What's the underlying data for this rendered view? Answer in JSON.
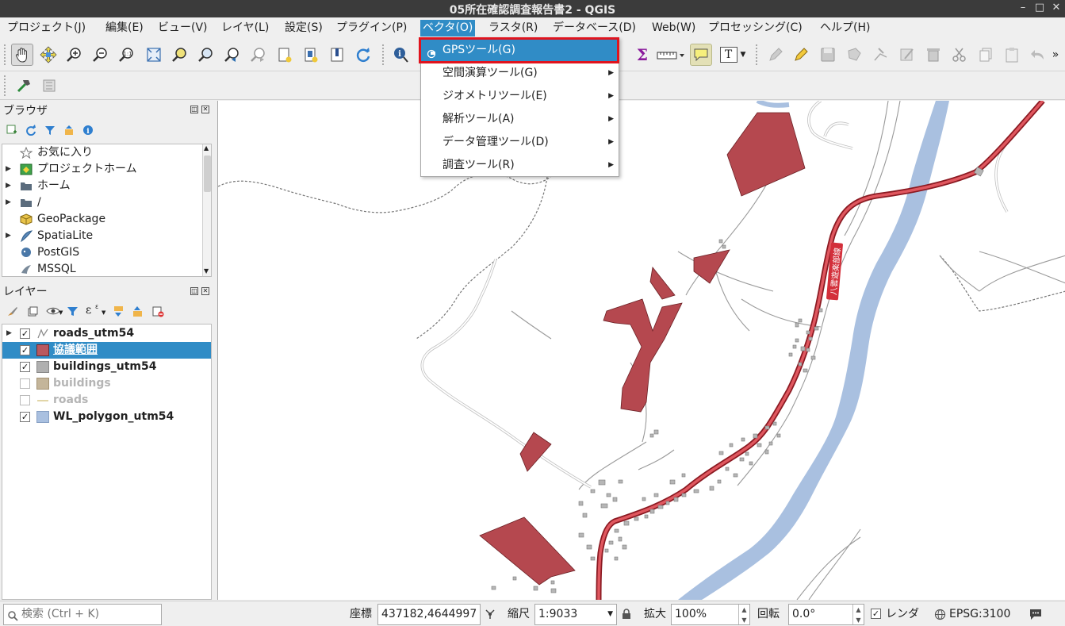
{
  "window": {
    "title": "05所在確認調査報告書2 - QGIS",
    "minimize_glyph": "–",
    "maximize_glyph": "□",
    "close_glyph": "✕"
  },
  "menubar": {
    "items": [
      {
        "label": "プロジェクト(J)"
      },
      {
        "label": "編集(E)"
      },
      {
        "label": "ビュー(V)"
      },
      {
        "label": "レイヤ(L)"
      },
      {
        "label": "設定(S)"
      },
      {
        "label": "プラグイン(P)"
      },
      {
        "label": "ベクタ(O)"
      },
      {
        "label": "ラスタ(R)"
      },
      {
        "label": "データベース(D)"
      },
      {
        "label": "Web(W)"
      },
      {
        "label": "プロセッシング(C)"
      },
      {
        "label": "ヘルプ(H)"
      }
    ],
    "active_index": 6
  },
  "vector_menu": {
    "items": [
      {
        "label": "GPSツール(G)",
        "icon": "gps-icon",
        "submenu": false
      },
      {
        "label": "空間演算ツール(G)",
        "submenu": true
      },
      {
        "label": "ジオメトリツール(E)",
        "submenu": true
      },
      {
        "label": "解析ツール(A)",
        "submenu": true
      },
      {
        "label": "データ管理ツール(D)",
        "submenu": true
      },
      {
        "label": "調査ツール(R)",
        "submenu": true
      }
    ],
    "highlighted_index": 0,
    "submenu_arrow": "▶"
  },
  "toolbar": {
    "overflow_glyph": "»",
    "sigma_glyph": "Σ",
    "text_glyph": "T"
  },
  "browser_panel": {
    "title": "ブラウザ",
    "items": [
      {
        "label": "お気に入り",
        "icon": "star-icon",
        "expandable": false
      },
      {
        "label": "プロジェクトホーム",
        "icon": "project-home-icon",
        "expandable": true
      },
      {
        "label": "ホーム",
        "icon": "folder-icon",
        "expandable": true
      },
      {
        "label": "/",
        "icon": "folder-icon",
        "expandable": true
      },
      {
        "label": "GeoPackage",
        "icon": "geopackage-icon",
        "expandable": false
      },
      {
        "label": "SpatiaLite",
        "icon": "spatialite-icon",
        "expandable": true
      },
      {
        "label": "PostGIS",
        "icon": "postgis-icon",
        "expandable": false
      },
      {
        "label": "MSSQL",
        "icon": "mssql-icon",
        "expandable": false
      }
    ]
  },
  "layers_panel": {
    "title": "レイヤー",
    "epsilon_glyph": "ε",
    "layers": [
      {
        "name": "roads_utm54",
        "checked": true,
        "symbol": "line",
        "color": "#b0b0b0",
        "expandable": true,
        "selected": false,
        "dim": false
      },
      {
        "name": "協議範囲",
        "checked": true,
        "symbol": "fill",
        "color": "#b9585f",
        "expandable": false,
        "selected": true,
        "dim": false
      },
      {
        "name": "buildings_utm54",
        "checked": true,
        "symbol": "fill",
        "color": "#b0b0b0",
        "expandable": false,
        "selected": false,
        "dim": false
      },
      {
        "name": "buildings",
        "checked": false,
        "symbol": "fill",
        "color": "#c4b59a",
        "expandable": false,
        "selected": false,
        "dim": true
      },
      {
        "name": "roads",
        "checked": false,
        "symbol": "line",
        "color": "#d9c98a",
        "expandable": false,
        "selected": false,
        "dim": true
      },
      {
        "name": "WL_polygon_utm54",
        "checked": true,
        "symbol": "fill",
        "color": "#a9c0e0",
        "expandable": false,
        "selected": false,
        "dim": false
      }
    ]
  },
  "map": {
    "road_label": "八雲遊楽部線",
    "colors": {
      "survey_area": "#b5484f",
      "river": "#a9c0e0",
      "main_road": "#d32f3a",
      "minor_road": "#b3b3b3",
      "building": "#b6b6b6"
    }
  },
  "statusbar": {
    "search_placeholder": "検索 (Ctrl + K)",
    "coord_label": "座標",
    "coord_value": "437182,4644997",
    "scale_label": "縮尺",
    "scale_value": "1:9033",
    "magnifier_label": "拡大",
    "magnifier_value": "100%",
    "rotation_label": "回転",
    "rotation_value": "0.0°",
    "render_label": "レンダ",
    "render_checked": true,
    "crs_label": "EPSG:3100"
  }
}
